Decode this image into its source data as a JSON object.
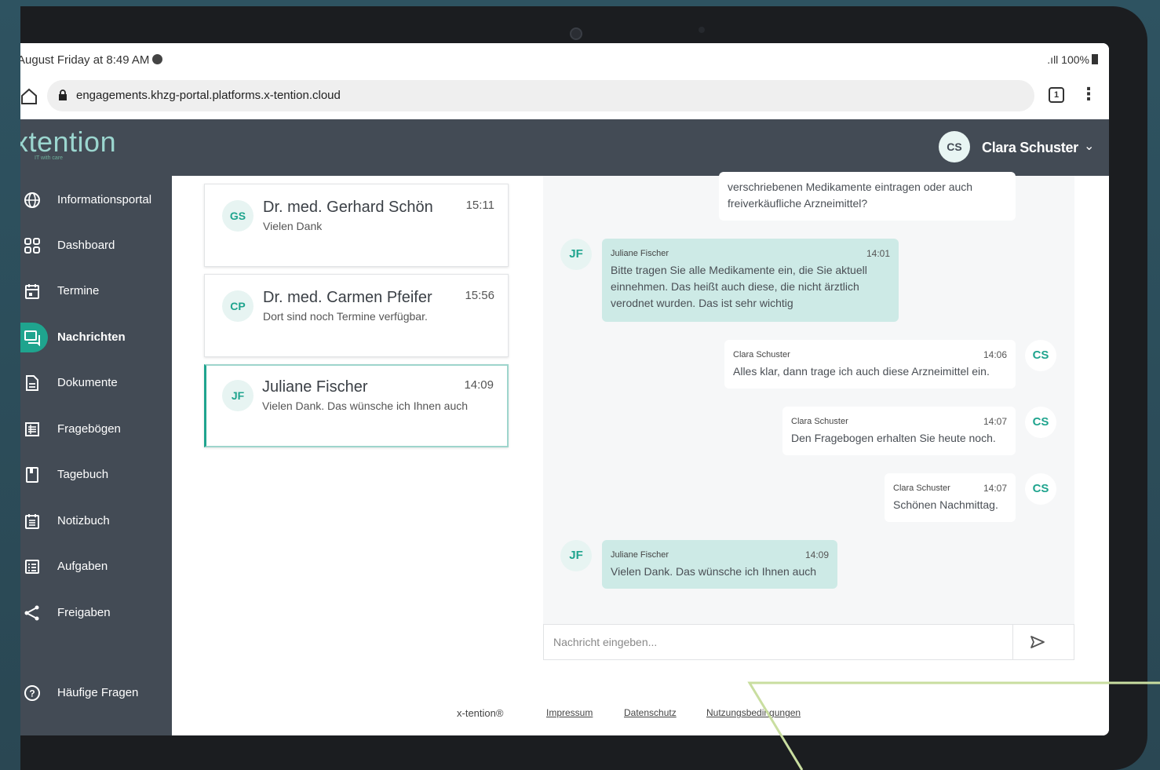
{
  "status": {
    "time": "August Friday at 8:49 AM",
    "signal_battery": ".ıll 100%"
  },
  "browser": {
    "url": "engagements.khzg-portal.platforms.x-tention.cloud",
    "tab_count": "1",
    "menu": "⋮"
  },
  "header": {
    "logo": "xtention",
    "logo_sub": "IT with care",
    "user_initials": "CS",
    "user_name": "Clara Schuster",
    "chevron": "⌄"
  },
  "sidebar": {
    "items": [
      {
        "label": "Informationsportal",
        "icon": "globe-icon"
      },
      {
        "label": "Dashboard",
        "icon": "grid-icon"
      },
      {
        "label": "Termine",
        "icon": "calendar-icon"
      },
      {
        "label": "Nachrichten",
        "icon": "chat-icon",
        "active": true
      },
      {
        "label": "Dokumente",
        "icon": "document-icon"
      },
      {
        "label": "Fragebögen",
        "icon": "list-icon"
      },
      {
        "label": "Tagebuch",
        "icon": "book-icon"
      },
      {
        "label": "Notizbuch",
        "icon": "notebook-icon"
      },
      {
        "label": "Aufgaben",
        "icon": "tasks-icon"
      },
      {
        "label": "Freigaben",
        "icon": "share-icon"
      }
    ],
    "help": {
      "label": "Häufige Fragen",
      "icon": "help-icon"
    }
  },
  "conversations": [
    {
      "initials": "GS",
      "name": "Dr. med. Gerhard Schön",
      "time": "15:11",
      "preview": "Vielen Dank"
    },
    {
      "initials": "CP",
      "name": "Dr. med. Carmen Pfeifer",
      "time": "15:56",
      "preview": "Dort sind noch Termine verfügbar."
    },
    {
      "initials": "JF",
      "name": "Juliane Fischer",
      "time": "14:09",
      "preview": "Vielen Dank. Das wünsche ich Ihnen auch",
      "selected": true
    }
  ],
  "messages": [
    {
      "from": "me",
      "sender": "",
      "time": "",
      "text": "verschriebenen Medikamente eintragen oder auch freiverkäufliche Arzneimittel?"
    },
    {
      "from": "them",
      "initials": "JF",
      "sender": "Juliane Fischer",
      "time": "14:01",
      "text": "Bitte tragen Sie alle Medikamente ein, die Sie aktuell einnehmen. Das heißt auch diese, die nicht ärztlich verodnet wurden. Das ist sehr wichtig"
    },
    {
      "from": "me",
      "initials": "CS",
      "sender": "Clara Schuster",
      "time": "14:06",
      "text": "Alles klar, dann trage ich auch diese Arzneimittel ein."
    },
    {
      "from": "me",
      "initials": "CS",
      "sender": "Clara Schuster",
      "time": "14:07",
      "text": "Den Fragebogen erhalten Sie heute noch."
    },
    {
      "from": "me",
      "initials": "CS",
      "sender": "Clara Schuster",
      "time": "14:07",
      "text": "Schönen Nachmittag."
    },
    {
      "from": "them",
      "initials": "JF",
      "sender": "Juliane Fischer",
      "time": "14:09",
      "text": "Vielen Dank. Das wünsche ich Ihnen auch"
    }
  ],
  "composer": {
    "placeholder": "Nachricht eingeben..."
  },
  "footer": {
    "brand": "x-tention®",
    "links": [
      "Impressum",
      "Datenschutz",
      "Nutzungsbedingungen"
    ]
  },
  "colors": {
    "accent": "#1fa48e",
    "sidebar": "#434b55",
    "bubble_them": "#cdeae6",
    "deco_line": "#c9dea0"
  }
}
